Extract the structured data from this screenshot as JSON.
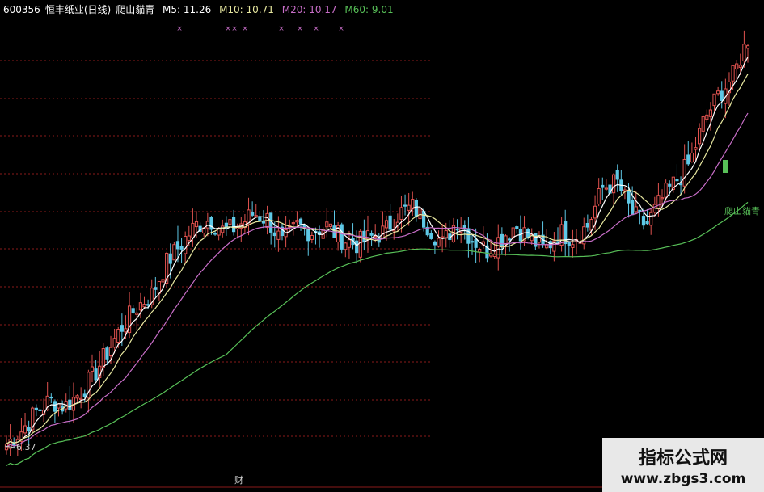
{
  "header": {
    "code": "600356",
    "name": "恒丰纸业(日线)",
    "indicator": "爬山貓青",
    "ma5": "M5: 11.26",
    "ma10": "M10: 10.71",
    "ma20": "M20: 10.17",
    "ma60": "M60: 9.01"
  },
  "colors": {
    "up": "#e0524f",
    "down": "#5ec8e6",
    "ma5": "#ffffff",
    "ma10": "#e8e8a0",
    "ma20": "#c86ec8",
    "ma60": "#58c058",
    "grid": "#8a1a1a",
    "marker": "#c86ec8"
  },
  "annotations": {
    "low_label": "6.37",
    "curve_label": "爬山貓青",
    "bottom_label": "财"
  },
  "watermark": {
    "title": "指标公式网",
    "url": "www.zbgs3.com"
  },
  "chart_data": {
    "type": "candlestick",
    "title": "600356 恒丰纸业(日线)",
    "y_range": [
      6.0,
      13.0
    ],
    "close_trend": [
      6.4,
      6.6,
      6.9,
      7.1,
      7.0,
      7.2,
      7.5,
      7.9,
      8.3,
      8.6,
      8.8,
      9.3,
      9.6,
      9.9,
      10.0,
      9.8,
      9.9,
      10.1,
      10.0,
      9.6,
      9.9,
      9.8,
      9.9,
      9.7,
      9.6,
      9.7,
      9.8,
      10.1,
      10.2,
      9.9,
      9.6,
      10.0,
      9.7,
      9.5,
      9.7,
      9.9,
      9.7,
      9.5,
      9.8,
      9.7,
      9.9,
      10.5,
      10.6,
      10.1,
      9.9,
      10.3,
      10.6,
      10.9,
      11.6,
      12.0,
      12.3,
      12.9
    ],
    "series": [
      {
        "name": "M5",
        "last": 11.26
      },
      {
        "name": "M10",
        "last": 10.71
      },
      {
        "name": "M20",
        "last": 10.17
      },
      {
        "name": "M60",
        "last": 9.01
      }
    ],
    "annotations": [
      "6.37",
      "爬山貓青"
    ]
  }
}
